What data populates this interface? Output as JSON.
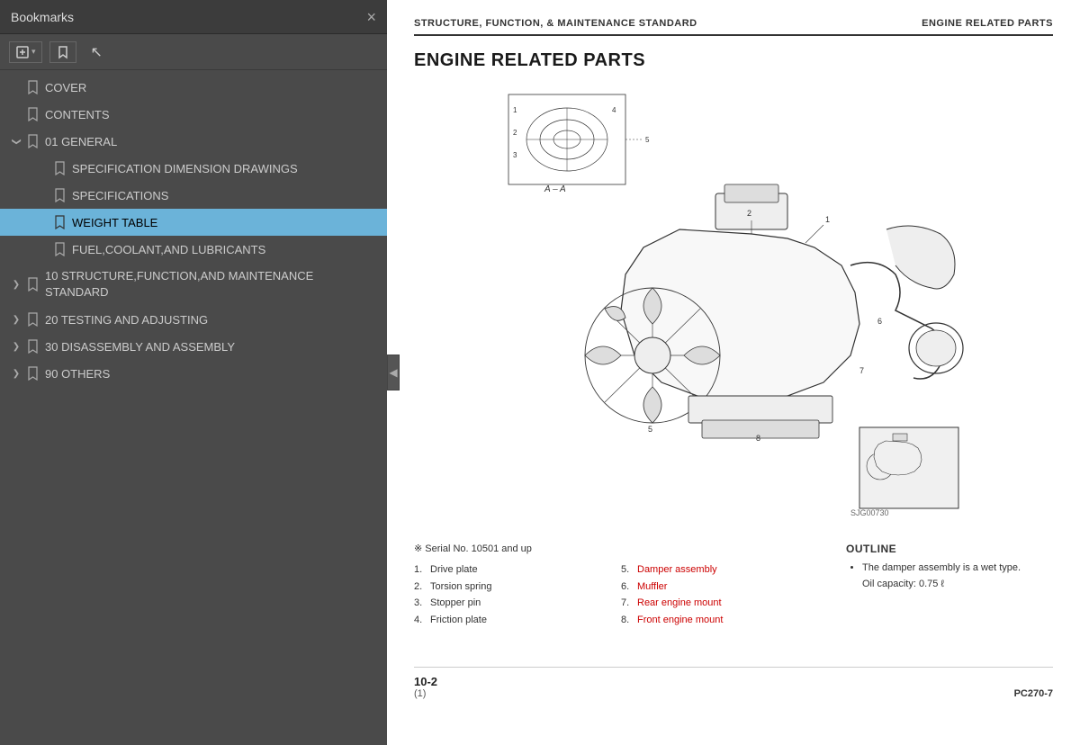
{
  "left": {
    "title": "Bookmarks",
    "close_label": "×",
    "items": [
      {
        "id": "cover",
        "label": "COVER",
        "level": 0,
        "expandable": false,
        "active": false
      },
      {
        "id": "contents",
        "label": "CONTENTS",
        "level": 0,
        "expandable": false,
        "active": false
      },
      {
        "id": "general",
        "label": "01 GENERAL",
        "level": 0,
        "expandable": true,
        "expanded": true,
        "active": false
      },
      {
        "id": "spec-dim",
        "label": "SPECIFICATION DIMENSION DRAWINGS",
        "level": 1,
        "expandable": false,
        "active": false
      },
      {
        "id": "specifications",
        "label": "SPECIFICATIONS",
        "level": 1,
        "expandable": false,
        "active": false
      },
      {
        "id": "weight-table",
        "label": "WEIGHT TABLE",
        "level": 1,
        "expandable": false,
        "active": true
      },
      {
        "id": "fuel",
        "label": "FUEL,COOLANT,AND LUBRICANTS",
        "level": 1,
        "expandable": false,
        "active": false
      },
      {
        "id": "structure",
        "label": "10 STRUCTURE,FUNCTION,AND MAINTENANCE STANDARD",
        "level": 0,
        "expandable": true,
        "expanded": false,
        "active": false
      },
      {
        "id": "testing",
        "label": "20 TESTING AND ADJUSTING",
        "level": 0,
        "expandable": true,
        "expanded": false,
        "active": false
      },
      {
        "id": "disassembly",
        "label": "30 DISASSEMBLY AND ASSEMBLY",
        "level": 0,
        "expandable": true,
        "expanded": false,
        "active": false
      },
      {
        "id": "others",
        "label": "90 OTHERS",
        "level": 0,
        "expandable": true,
        "expanded": false,
        "active": false
      }
    ],
    "collapse_arrow": "◀"
  },
  "right": {
    "header_left": "STRUCTURE, FUNCTION, & MAINTENANCE STANDARD",
    "header_right": "ENGINE RELATED PARTS",
    "section_title": "ENGINE RELATED PARTS",
    "diagram_caption": "A – A",
    "image_code": "SJG00730",
    "serial_note": "※  Serial No. 10501 and up",
    "parts": [
      {
        "num": "1.",
        "label": "Drive plate"
      },
      {
        "num": "2.",
        "label": "Torsion spring"
      },
      {
        "num": "3.",
        "label": "Stopper pin"
      },
      {
        "num": "4.",
        "label": "Friction plate"
      },
      {
        "num": "5.",
        "label": "Damper assembly"
      },
      {
        "num": "6.",
        "label": "Muffler"
      },
      {
        "num": "7.",
        "label": "Rear engine mount"
      },
      {
        "num": "8.",
        "label": "Front engine mount"
      }
    ],
    "outline_title": "OUTLINE",
    "outline_items": [
      "The damper assembly is a wet type. Oil capacity: 0.75 ℓ"
    ],
    "page_number": "10-2",
    "page_sub": "(1)",
    "doc_ref": "PC270-7"
  }
}
